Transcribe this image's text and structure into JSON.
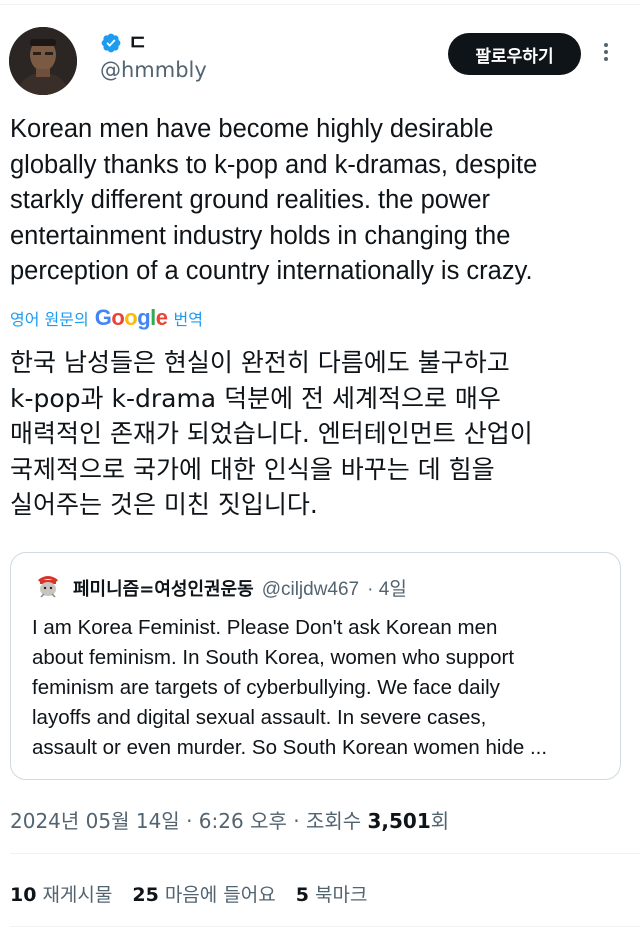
{
  "header": {
    "display_name": "ㄷ",
    "handle": "@hmmbly",
    "follow_label": "팔로우하기"
  },
  "tweet": {
    "text": "Korean men have become highly desirable\nglobally thanks to k-pop and k-dramas, despite\nstarkly different ground realities. the power\nentertainment industry holds in changing the\nperception of a country internationally is crazy.",
    "translate_prefix": "영어 원문의",
    "translate_brand": "Google",
    "translate_suffix": "번역",
    "translated_text": "한국 남성들은 현실이 완전히 다름에도 불구하고\nk-pop과 k-drama 덕분에 전 세계적으로 매우\n매력적인 존재가 되었습니다. 엔터테인먼트 산업이\n국제적으로 국가에 대한 인식을 바꾸는 데 힘을\n실어주는 것은 미친 짓입니다."
  },
  "quote": {
    "name": "페미니즘=여성인권운동",
    "handle": "@ciljdw467",
    "time": "· 4일",
    "text": "I am Korea Feminist. Please Don't ask Korean men\nabout feminism. In South Korea, women who support\nfeminism are targets of cyberbullying. We face daily\nlayoffs and digital sexual assault. In severe cases,\nassault or even murder. So South Korean women hide ..."
  },
  "meta": {
    "date": "2024년 05월 14일",
    "time": "· 6:26 오후 ·",
    "views_label": "조회수",
    "views_count": "3,501",
    "views_suffix": "회"
  },
  "stats": {
    "reposts_count": "10",
    "reposts_label": "재게시물",
    "likes_count": "25",
    "likes_label": "마음에 들어요",
    "bookmarks_count": "5",
    "bookmarks_label": "북마크"
  },
  "colors": {
    "link_blue": "#1d9bf0",
    "text_primary": "#0f1419",
    "text_secondary": "#536471",
    "button_bg": "#0f1419"
  },
  "icons": {
    "verified": "verified-badge-icon",
    "more": "more-vertical-icon"
  }
}
